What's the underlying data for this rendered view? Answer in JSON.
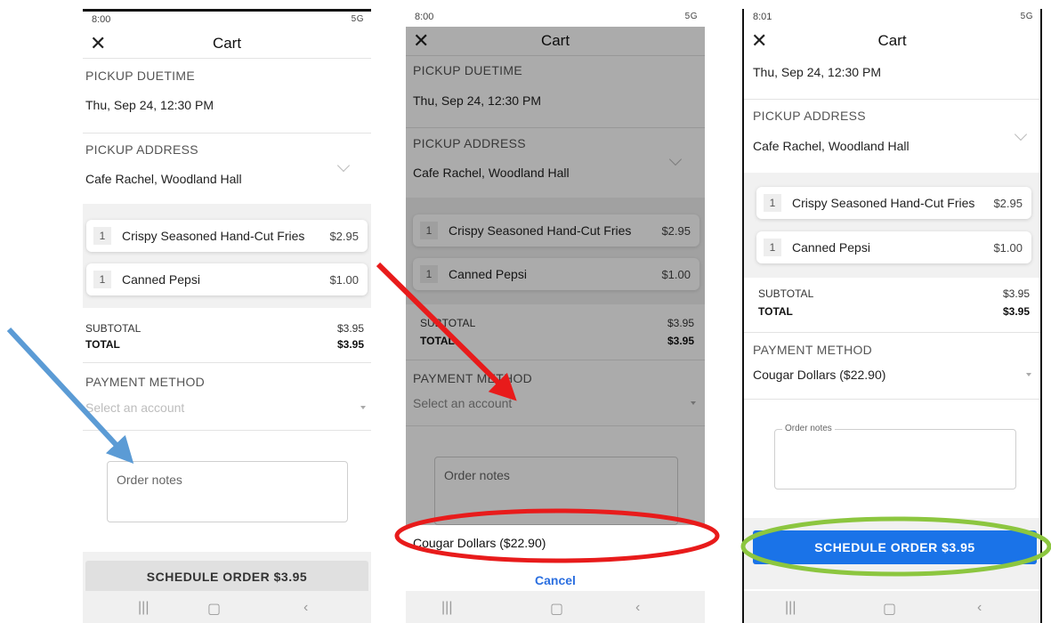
{
  "screens": [
    {
      "status_time": "8:00",
      "status_right": "5G",
      "title": "Cart",
      "pickup_duetime_label": "PICKUP DUETIME",
      "pickup_duetime_value": "Thu, Sep 24, 12:30 PM",
      "pickup_address_label": "PICKUP ADDRESS",
      "pickup_address_value": "Cafe Rachel, Woodland Hall",
      "items": [
        {
          "qty": "1",
          "name": "Crispy Seasoned Hand-Cut Fries",
          "price": "$2.95"
        },
        {
          "qty": "1",
          "name": "Canned Pepsi",
          "price": "$1.00"
        }
      ],
      "subtotal_label": "SUBTOTAL",
      "subtotal_value": "$3.95",
      "total_label": "TOTAL",
      "total_value": "$3.95",
      "payment_label": "PAYMENT METHOD",
      "payment_placeholder": "Select an account",
      "notes_placeholder": "Order notes",
      "schedule_label": "SCHEDULE ORDER $3.95"
    },
    {
      "status_time": "8:00",
      "status_right": "5G",
      "title": "Cart",
      "pickup_duetime_label": "PICKUP DUETIME",
      "pickup_duetime_value": "Thu, Sep 24, 12:30 PM",
      "pickup_address_label": "PICKUP ADDRESS",
      "pickup_address_value": "Cafe Rachel, Woodland Hall",
      "items": [
        {
          "qty": "1",
          "name": "Crispy Seasoned Hand-Cut Fries",
          "price": "$2.95"
        },
        {
          "qty": "1",
          "name": "Canned Pepsi",
          "price": "$1.00"
        }
      ],
      "subtotal_label": "SUBTOTAL",
      "subtotal_value": "$3.95",
      "total_label": "TOTAL",
      "total_value": "$3.95",
      "payment_label": "PAYMENT METHOD",
      "payment_placeholder": "Select an account",
      "notes_placeholder": "Order notes",
      "sheet_option": "Cougar Dollars ($22.90)",
      "sheet_cancel": "Cancel"
    },
    {
      "status_time": "8:01",
      "status_right": "5G",
      "title": "Cart",
      "pickup_duetime_value": "Thu, Sep 24, 12:30 PM",
      "pickup_address_label": "PICKUP ADDRESS",
      "pickup_address_value": "Cafe Rachel, Woodland Hall",
      "items": [
        {
          "qty": "1",
          "name": "Crispy Seasoned Hand-Cut Fries",
          "price": "$2.95"
        },
        {
          "qty": "1",
          "name": "Canned Pepsi",
          "price": "$1.00"
        }
      ],
      "subtotal_label": "SUBTOTAL",
      "subtotal_value": "$3.95",
      "total_label": "TOTAL",
      "total_value": "$3.95",
      "payment_label": "PAYMENT METHOD",
      "payment_value": "Cougar Dollars ($22.90)",
      "notes_legend": "Order notes",
      "schedule_label": "SCHEDULE ORDER $3.95"
    }
  ],
  "annotation_colors": {
    "arrow_1": "#5b9bd5",
    "arrow_2": "#e81b1b",
    "ellipse_red": "#e81b1b",
    "ellipse_green": "#8cc63f",
    "schedule_enabled": "#1a73e8",
    "schedule_disabled": "#e0e0e0"
  }
}
